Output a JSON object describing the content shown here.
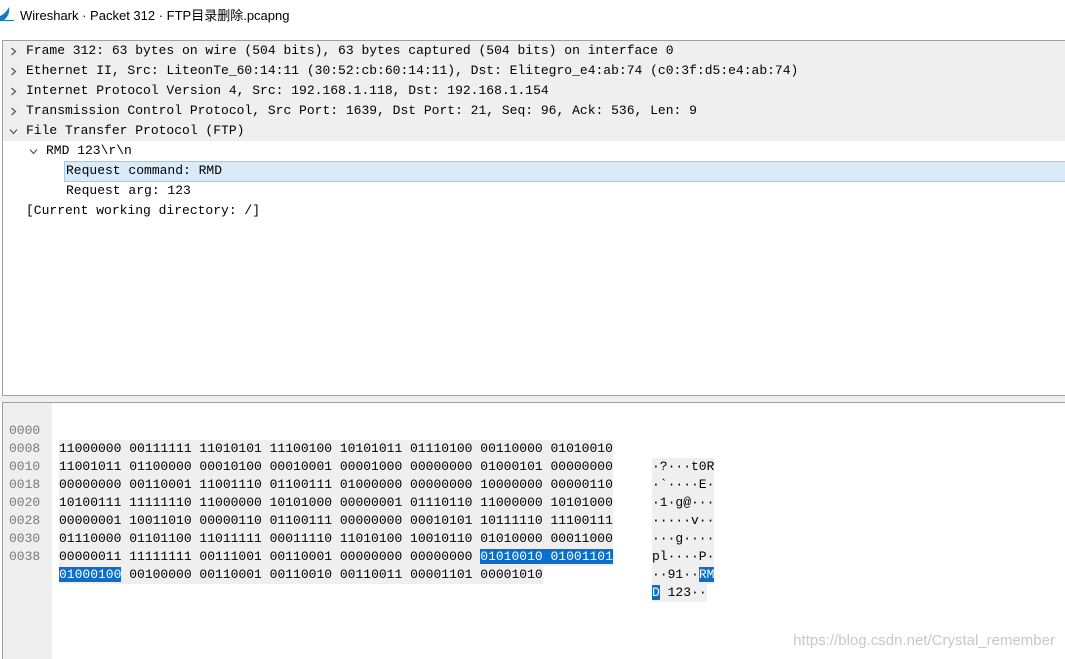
{
  "window": {
    "title": "Wireshark · Packet 312 · FTP目录删除.pcapng",
    "accent_color": "#0a6ecb"
  },
  "details": {
    "rows": [
      {
        "text": "Frame 312: 63 bytes on wire (504 bits), 63 bytes captured (504 bits) on interface 0",
        "expanded": false
      },
      {
        "text": "Ethernet II, Src: LiteonTe_60:14:11 (30:52:cb:60:14:11), Dst: Elitegro_e4:ab:74 (c0:3f:d5:e4:ab:74)",
        "expanded": false
      },
      {
        "text": "Internet Protocol Version 4, Src: 192.168.1.118, Dst: 192.168.1.154",
        "expanded": false
      },
      {
        "text": "Transmission Control Protocol, Src Port: 1639, Dst Port: 21, Seq: 96, Ack: 536, Len: 9",
        "expanded": false
      },
      {
        "text": "File Transfer Protocol (FTP)",
        "expanded": true
      },
      {
        "text": "RMD 123\\r\\n",
        "expanded": true
      },
      {
        "text": "Request command: RMD",
        "selected": true
      },
      {
        "text": "Request arg: 123"
      },
      {
        "text": "[Current working directory: /]"
      }
    ]
  },
  "bytes": {
    "rows": [
      {
        "offset": "0000",
        "bits": "11000000 00111111 11010101 11100100 10101011 01110100 00110000 01010010",
        "ascii": "·?···t0R"
      },
      {
        "offset": "0008",
        "bits": "11001011 01100000 00010100 00010001 00001000 00000000 01000101 00000000",
        "ascii": "·`····E·"
      },
      {
        "offset": "0010",
        "bits": "00000000 00110001 11001110 01100111 01000000 00000000 10000000 00000110",
        "ascii": "·1·g@···"
      },
      {
        "offset": "0018",
        "bits": "10100111 11111110 11000000 10101000 00000001 01110110 11000000 10101000",
        "ascii": "·····v··"
      },
      {
        "offset": "0020",
        "bits": "00000001 10011010 00000110 01100111 00000000 00010101 10111110 11100111",
        "ascii": "···g····"
      },
      {
        "offset": "0028",
        "bits": "01110000 01101100 11011111 00011110 11010100 10010110 01010000 00011000",
        "ascii": "pl····P·"
      },
      {
        "offset": "0030",
        "bits_plain": "00000011 11111111 00111001 00110001 00000000 00000000 ",
        "bits_hl": "01010010 01001101",
        "ascii_plain": "··91··",
        "ascii_hl": "RM"
      },
      {
        "offset": "0038",
        "bits_hl": "01000100",
        "bits_plain": " 00100000 00110001 00110010 00110011 00001101 00001010",
        "ascii_hl": "D",
        "ascii_plain": " 123··"
      }
    ]
  },
  "watermark": "https://blog.csdn.net/Crystal_remember"
}
